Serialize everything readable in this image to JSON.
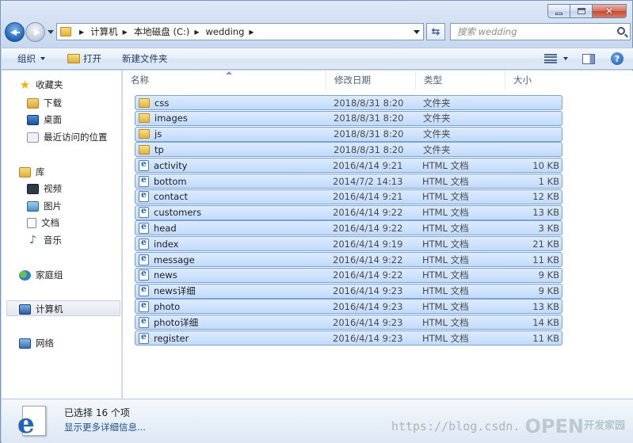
{
  "navbar": {
    "breadcrumbs": [
      "计算机",
      "本地磁盘 (C:)",
      "wedding"
    ],
    "search_placeholder": "搜索 wedding"
  },
  "toolbar": {
    "organize": "组织",
    "open": "打开",
    "new_folder": "新建文件夹"
  },
  "sidebar": {
    "favorites": "收藏夹",
    "downloads": "下载",
    "desktop": "桌面",
    "recent": "最近访问的位置",
    "libraries": "库",
    "videos": "视频",
    "pictures": "图片",
    "documents": "文档",
    "music": "音乐",
    "homegroup": "家庭组",
    "computer": "计算机",
    "network": "网络"
  },
  "columns": {
    "name": "名称",
    "date": "修改日期",
    "type": "类型",
    "size": "大小"
  },
  "files": [
    {
      "name": "css",
      "date": "2018/8/31 8:20",
      "type": "文件夹",
      "size": "",
      "kind": "folder"
    },
    {
      "name": "images",
      "date": "2018/8/31 8:20",
      "type": "文件夹",
      "size": "",
      "kind": "folder"
    },
    {
      "name": "js",
      "date": "2018/8/31 8:20",
      "type": "文件夹",
      "size": "",
      "kind": "folder"
    },
    {
      "name": "tp",
      "date": "2018/8/31 8:20",
      "type": "文件夹",
      "size": "",
      "kind": "folder"
    },
    {
      "name": "activity",
      "date": "2016/4/14 9:21",
      "type": "HTML 文档",
      "size": "10 KB",
      "kind": "html"
    },
    {
      "name": "bottom",
      "date": "2014/7/2 14:13",
      "type": "HTML 文档",
      "size": "1 KB",
      "kind": "html"
    },
    {
      "name": "contact",
      "date": "2016/4/14 9:21",
      "type": "HTML 文档",
      "size": "12 KB",
      "kind": "html"
    },
    {
      "name": "customers",
      "date": "2016/4/14 9:22",
      "type": "HTML 文档",
      "size": "13 KB",
      "kind": "html"
    },
    {
      "name": "head",
      "date": "2016/4/14 9:22",
      "type": "HTML 文档",
      "size": "3 KB",
      "kind": "html"
    },
    {
      "name": "index",
      "date": "2016/4/14 9:19",
      "type": "HTML 文档",
      "size": "21 KB",
      "kind": "html"
    },
    {
      "name": "message",
      "date": "2016/4/14 9:22",
      "type": "HTML 文档",
      "size": "11 KB",
      "kind": "html"
    },
    {
      "name": "news",
      "date": "2016/4/14 9:22",
      "type": "HTML 文档",
      "size": "9 KB",
      "kind": "html"
    },
    {
      "name": "news详细",
      "date": "2016/4/14 9:23",
      "type": "HTML 文档",
      "size": "9 KB",
      "kind": "html"
    },
    {
      "name": "photo",
      "date": "2016/4/14 9:23",
      "type": "HTML 文档",
      "size": "13 KB",
      "kind": "html"
    },
    {
      "name": "photo详细",
      "date": "2016/4/14 9:23",
      "type": "HTML 文档",
      "size": "14 KB",
      "kind": "html"
    },
    {
      "name": "register",
      "date": "2016/4/14 9:23",
      "type": "HTML 文档",
      "size": "11 KB",
      "kind": "html"
    }
  ],
  "details": {
    "selected": "已选择 16 个项",
    "more": "显示更多详细信息..."
  },
  "watermark": {
    "url": "https://blog.csdn.",
    "logo": "OPEN",
    "site": "开发家园"
  },
  "icons": {
    "folder": "folder-icon",
    "html": "ie-html-icon"
  }
}
